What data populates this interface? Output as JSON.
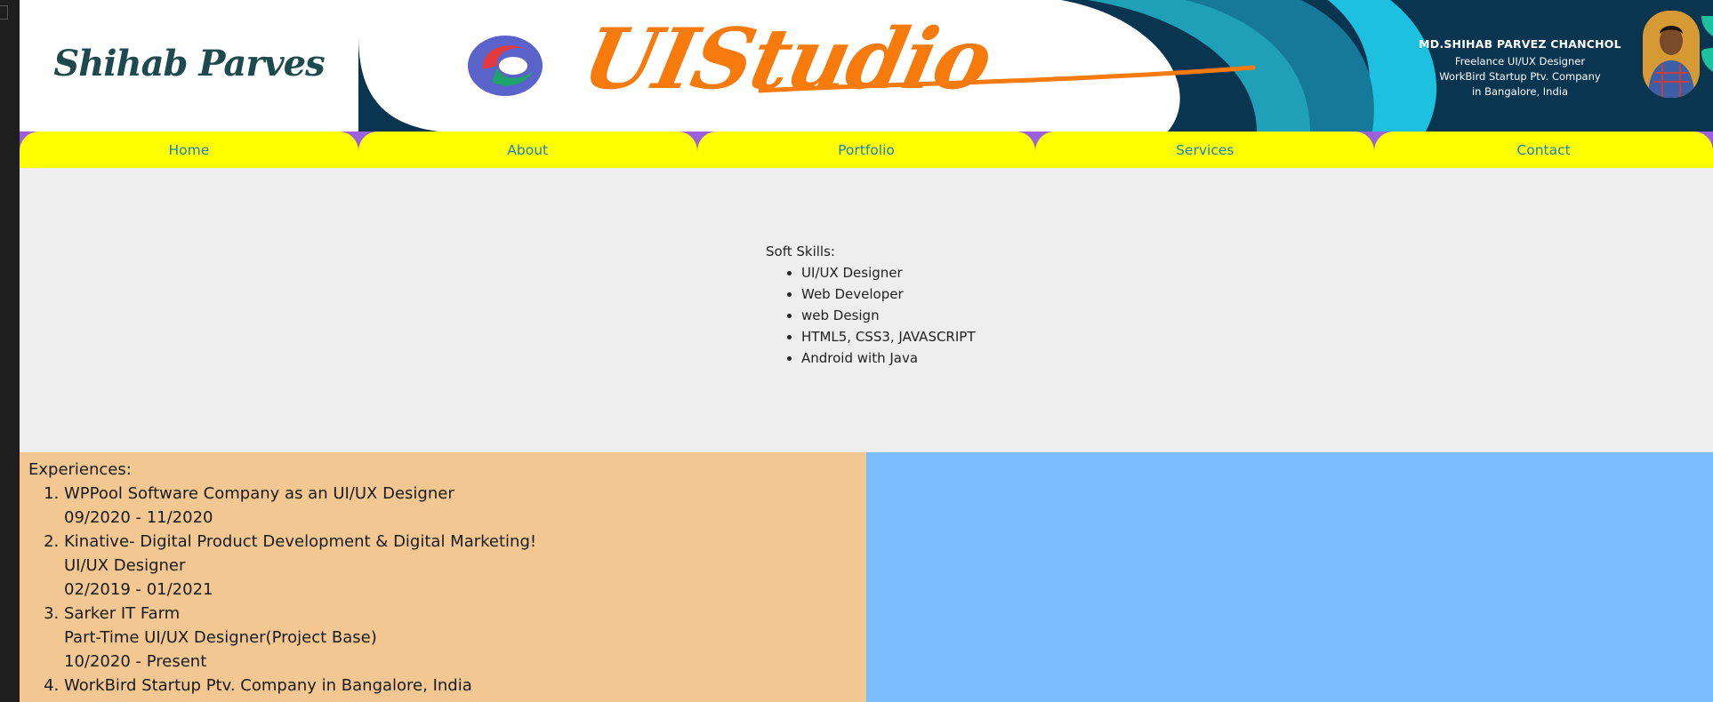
{
  "header": {
    "signature": "Shihab Parves",
    "banner_brand": "UIStudio",
    "profile": {
      "name": "MD.SHIHAB PARVEZ CHANCHOL",
      "role": "Freelance UI/UX Designer",
      "company": "WorkBird Startup Ptv. Company",
      "location": "in Bangalore, India"
    }
  },
  "nav": {
    "items": [
      {
        "label": "Home"
      },
      {
        "label": "About"
      },
      {
        "label": "Portfolio"
      },
      {
        "label": "Services"
      },
      {
        "label": "Contact"
      }
    ]
  },
  "skills": {
    "title": "Soft Skills:",
    "items": [
      "UI/UX Designer",
      "Web Developer",
      "web Design",
      "HTML5, CSS3, JAVASCRIPT",
      "Android with Java"
    ]
  },
  "experiences": {
    "title": "Experiences:",
    "items": [
      {
        "lines": [
          "WPPool Software Company as an UI/UX Designer",
          "09/2020 - 11/2020"
        ]
      },
      {
        "lines": [
          "Kinative- Digital Product Development & Digital Marketing!",
          "UI/UX Designer",
          "02/2019 - 01/2021"
        ]
      },
      {
        "lines": [
          "Sarker IT Farm",
          "Part-Time UI/UX Designer(Project Base)",
          "10/2020 - Present"
        ]
      },
      {
        "lines": [
          "WorkBird Startup Ptv. Company in Bangalore, India"
        ]
      }
    ]
  },
  "colors": {
    "nav_bg": "#ffff00",
    "nav_text": "#1a82c4",
    "nav_corner": "#9b5fe0",
    "experience_bg": "#f2c792",
    "right_panel_bg": "#7bbdfc",
    "brand_orange": "#f77a0d",
    "banner_dark": "#0a3550"
  }
}
